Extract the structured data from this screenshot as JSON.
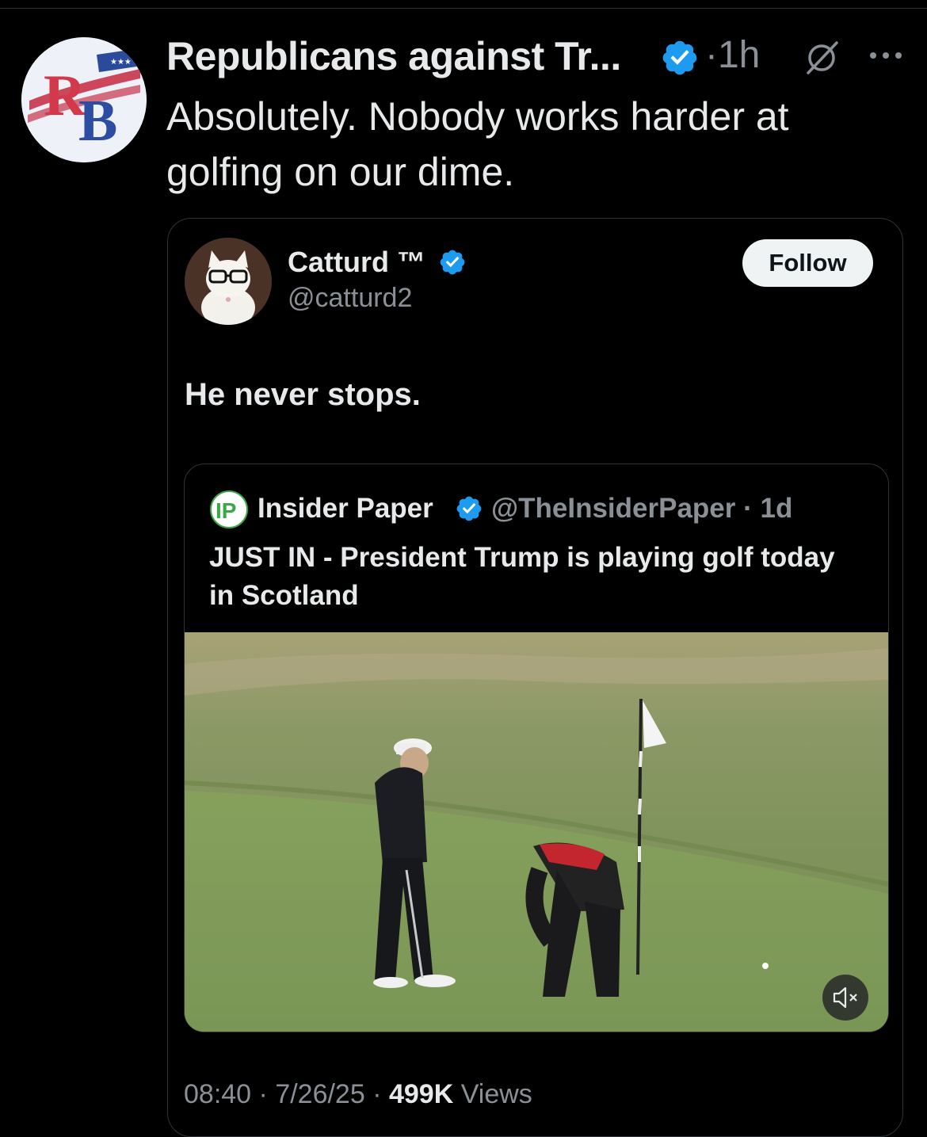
{
  "post": {
    "author_name": "Republicans against Tr...",
    "separator": "·",
    "time": "1h",
    "text": "Absolutely. Nobody works harder at golfing on our dime."
  },
  "quoted": {
    "name": "Catturd ™",
    "handle": "@catturd2",
    "follow_label": "Follow",
    "text": "He never stops.",
    "nested": {
      "name": "Insider Paper",
      "handle_time": "@TheInsiderPaper · 1d",
      "text": "JUST IN - President Trump is playing golf today in Scotland"
    }
  },
  "meta": {
    "time": "08:40",
    "sep1": " · ",
    "date": "7/26/25",
    "sep2": " · ",
    "views_count": "499K",
    "views_label": " Views"
  },
  "colors": {
    "background": "#000000",
    "verified": "#1d9bf0",
    "muted_text": "#8b9096",
    "card_border": "#2f3336"
  },
  "icons": [
    "verified-badge-icon",
    "grok-icon",
    "more-icon",
    "insider-paper-logo",
    "mute-icon"
  ]
}
